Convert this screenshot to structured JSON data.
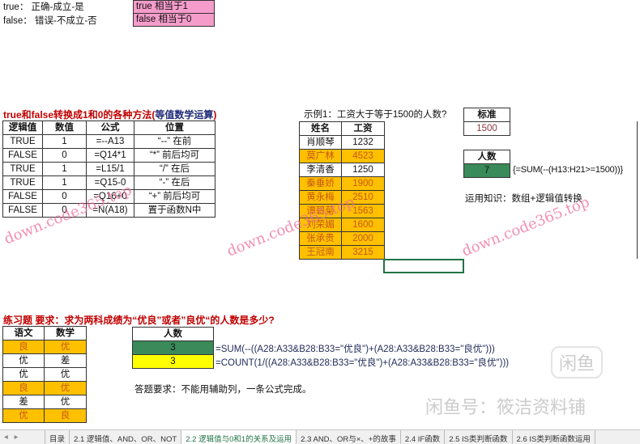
{
  "intro": {
    "true_line": "true： 正确-成立-是",
    "false_line": "false： 错误-不成立-否",
    "box": [
      "true  相当于1",
      "false 相当于0"
    ]
  },
  "section1": {
    "title_red": "true和false转换成1和0的各种方法(",
    "title_blue": "等值数学运算",
    "title_end": ")",
    "headers": [
      "逻辑值",
      "数值",
      "公式",
      "位置"
    ],
    "rows": [
      [
        "TRUE",
        "1",
        "=--A13",
        "“--” 在前"
      ],
      [
        "FALSE",
        "0",
        "=Q14*1",
        "“*” 前后均可"
      ],
      [
        "TRUE",
        "1",
        "=L15/1",
        "“/” 在后"
      ],
      [
        "TRUE",
        "1",
        "=Q15-0",
        "“-” 在后"
      ],
      [
        "FALSE",
        "0",
        "=Q16+0",
        "“+” 前后均可"
      ],
      [
        "FALSE",
        "0",
        "=N(A18)",
        "置于函数N中"
      ]
    ]
  },
  "example": {
    "title": "示例1：工资大于等于1500的人数?",
    "headers": [
      "姓名",
      "工资"
    ],
    "rows": [
      [
        "肖顺琴",
        "1232",
        false
      ],
      [
        "莫广林",
        "4523",
        true
      ],
      [
        "李清香",
        "1250",
        false
      ],
      [
        "秦垂娇",
        "1900",
        true
      ],
      [
        "黄永梅",
        "2510",
        true
      ],
      [
        "谭碧菊",
        "1563",
        true
      ],
      [
        "刘荣媚",
        "1600",
        true
      ],
      [
        "张承贵",
        "2000",
        true
      ],
      [
        "王冠南",
        "3215",
        true
      ]
    ],
    "standard_label": "标准",
    "standard_value": "1500",
    "count_label": "人数",
    "count_value": "7",
    "formula": "{=SUM(--(H13:H21>=1500))}",
    "knowledge": "运用知识：数组+逻辑值转换"
  },
  "exercise": {
    "title": "练习题  要求：求为两科成绩为“优良”或者”良优“的人数是多少?",
    "headers": [
      "语文",
      "数学"
    ],
    "rows": [
      [
        "良",
        "优",
        true
      ],
      [
        "优",
        "差",
        false
      ],
      [
        "优",
        "优",
        false
      ],
      [
        "良",
        "优",
        true
      ],
      [
        "差",
        "优",
        false
      ],
      [
        "优",
        "良",
        true
      ]
    ],
    "count_label": "人数",
    "answers": [
      "3",
      "3"
    ],
    "formulas": [
      "=SUM(--((A28:A33&B28:B33=\"优良\")+(A28:A33&B28:B33=\"良优\")))",
      "=COUNT(1/((A28:A33&B28:B33=\"优良\")+(A28:A33&B28:B33=\"良优\")))"
    ],
    "requirement": "答题要求：不能用辅助列，一条公式完成。"
  },
  "watermarks": [
    "down.code365.top",
    "down.code365.top",
    "down.code365.top",
    "闲鱼",
    "闲鱼号：筱洁资料铺"
  ],
  "tabs": [
    "目录",
    "2.1 逻辑值、AND、OR、NOT",
    "2.2 逻辑值与0和1的关系及运用",
    "2.3 AND、OR与×、+的故事",
    "2.4 IF函数",
    "2.5 IS类判断函数",
    "2.6 IS类判断函数运用"
  ],
  "active_tab": 2
}
